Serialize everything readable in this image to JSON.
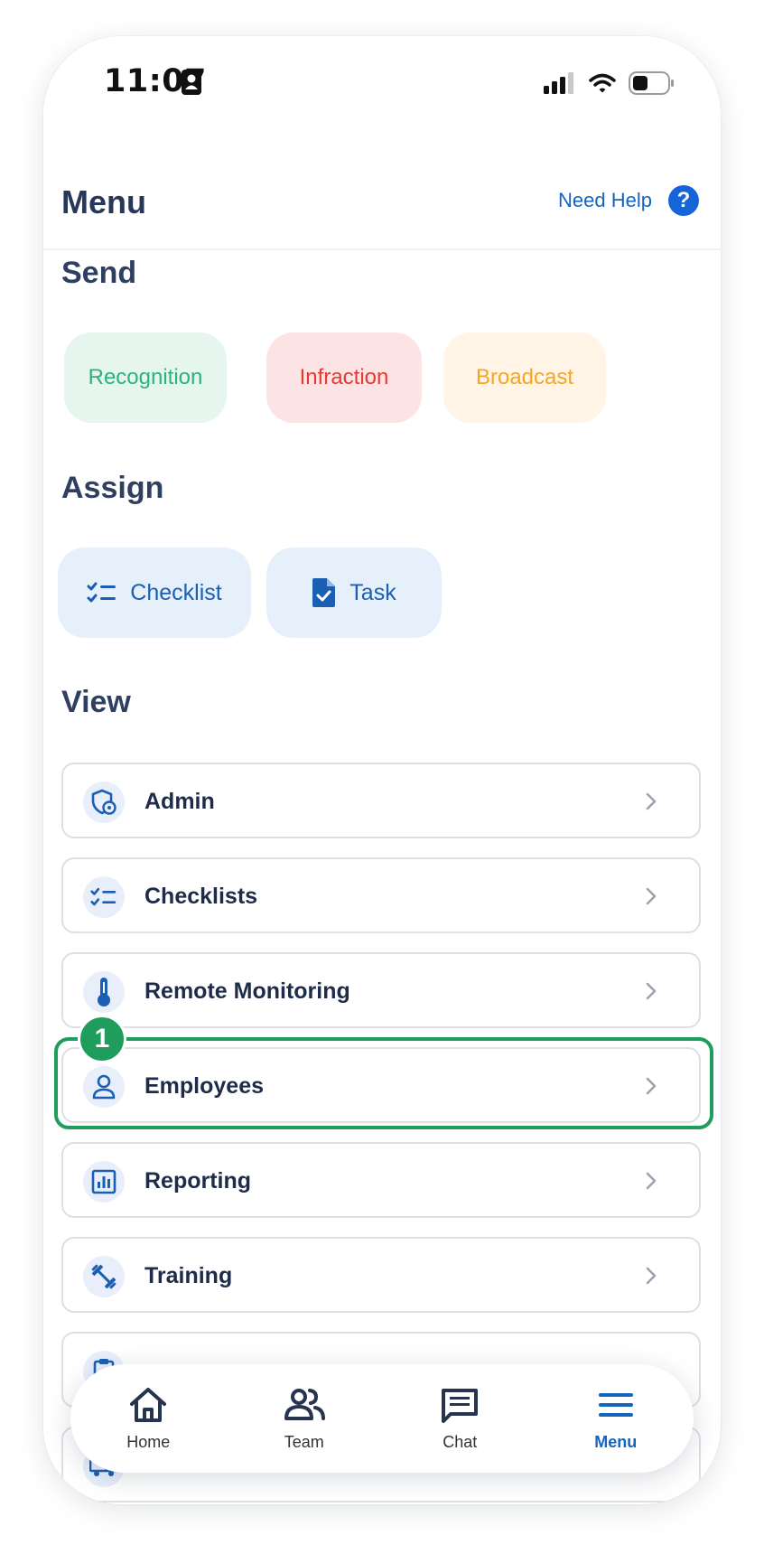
{
  "status_bar": {
    "time": "11:07"
  },
  "header": {
    "title": "Menu",
    "help_label": "Need Help",
    "help_symbol": "?"
  },
  "send": {
    "title": "Send",
    "buttons": [
      {
        "label": "Recognition",
        "color": "#2db37a",
        "bg": "#e6f6ef"
      },
      {
        "label": "Infraction",
        "color": "#e53935",
        "bg": "#fde4e4"
      },
      {
        "label": "Broadcast",
        "color": "#f5a623",
        "bg": "#fff4e5"
      }
    ]
  },
  "assign": {
    "title": "Assign",
    "buttons": [
      {
        "label": "Checklist",
        "icon": "checklist-icon"
      },
      {
        "label": "Task",
        "icon": "task-document-icon"
      }
    ]
  },
  "view": {
    "title": "View",
    "items": [
      {
        "label": "Admin",
        "icon": "shield-gear-icon"
      },
      {
        "label": "Checklists",
        "icon": "checklist-icon"
      },
      {
        "label": "Remote Monitoring",
        "icon": "thermometer-icon"
      },
      {
        "label": "Employees",
        "icon": "person-icon"
      },
      {
        "label": "Reporting",
        "icon": "bar-chart-icon"
      },
      {
        "label": "Training",
        "icon": "dumbbell-icon"
      },
      {
        "label": "",
        "icon": "clipboard-icon"
      },
      {
        "label": "",
        "icon": "truck-icon"
      }
    ]
  },
  "annotation": {
    "step": "1"
  },
  "tabbar": {
    "tabs": [
      {
        "label": "Home",
        "icon": "home-icon",
        "active": false
      },
      {
        "label": "Team",
        "icon": "team-icon",
        "active": false
      },
      {
        "label": "Chat",
        "icon": "chat-icon",
        "active": false
      },
      {
        "label": "Menu",
        "icon": "menu-icon",
        "active": true
      }
    ]
  },
  "colors": {
    "accent": "#1565c0",
    "highlight": "#1f9d5c",
    "heading": "#2f3f60"
  }
}
